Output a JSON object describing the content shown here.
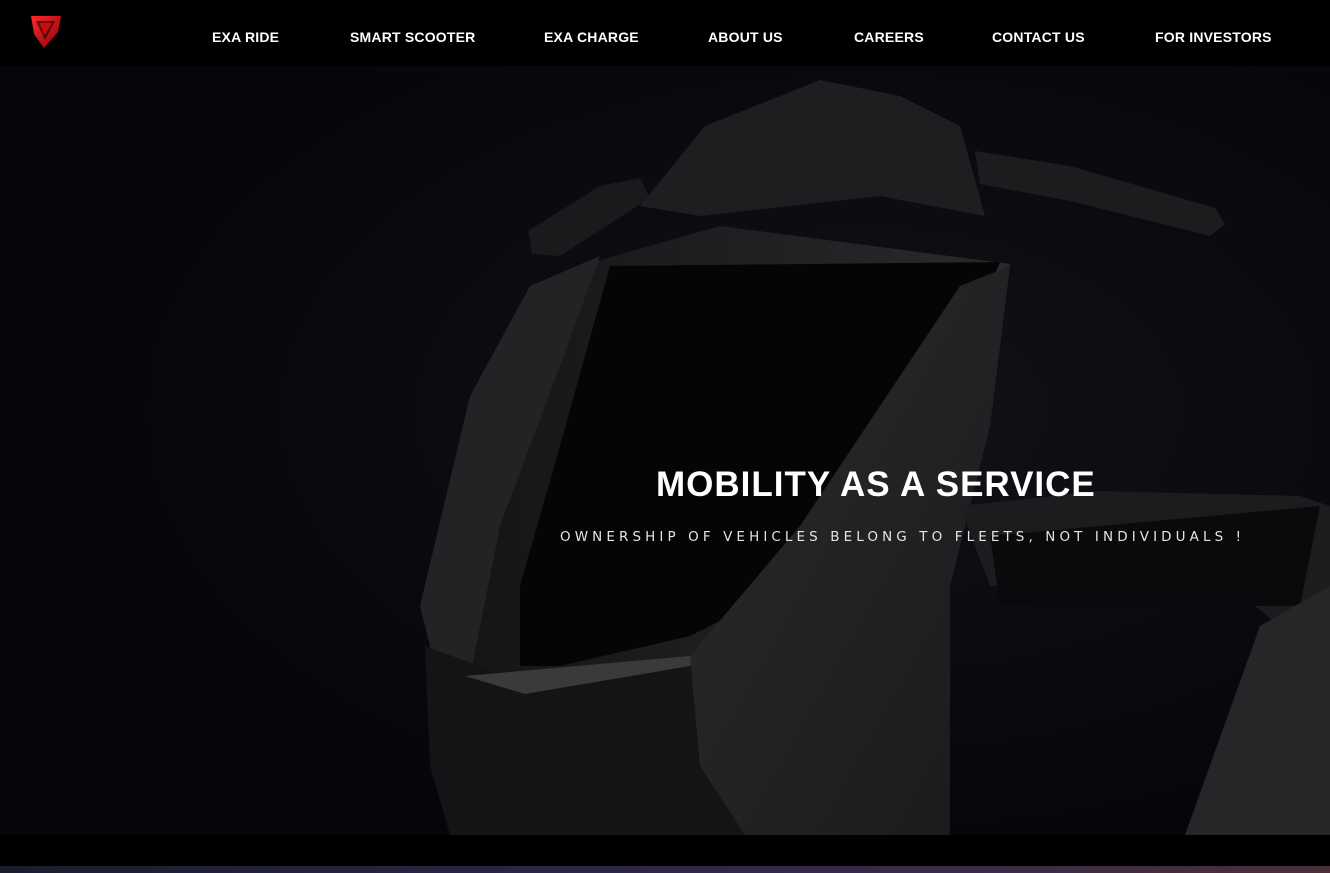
{
  "brand": {
    "logo_icon": "exa-logo-icon",
    "accent_color": "#d40d12"
  },
  "nav": {
    "items": [
      {
        "label": "EXA RIDE"
      },
      {
        "label": "SMART SCOOTER"
      },
      {
        "label": "EXA CHARGE"
      },
      {
        "label": "ABOUT US"
      },
      {
        "label": "CAREERS"
      },
      {
        "label": "CONTACT US"
      },
      {
        "label": "FOR INVESTORS"
      }
    ]
  },
  "hero": {
    "title": "MOBILITY AS A SERVICE",
    "subtitle": "OWNERSHIP OF VEHICLES BELONG TO FLEETS, NOT INDIVIDUALS !",
    "background_image": "scooter-front-dark"
  }
}
